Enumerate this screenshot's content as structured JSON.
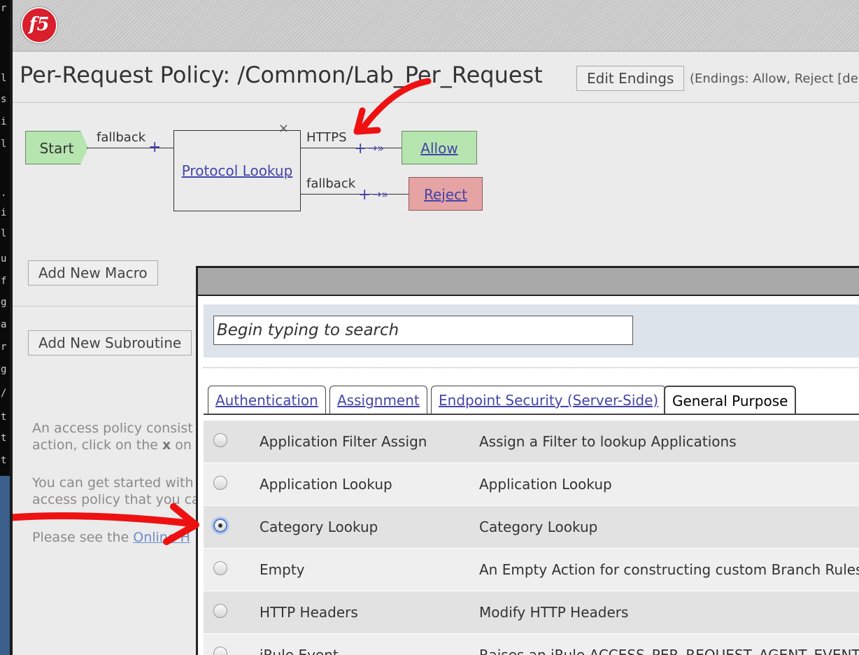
{
  "header": {
    "logo_text": "f5"
  },
  "policy": {
    "title": "Per-Request Policy: /Common/Lab_Per_Request",
    "edit_endings_label": "Edit Endings",
    "endings_note": "(Endings: Allow, Reject [de"
  },
  "flow": {
    "start": "Start",
    "start_branch": "fallback",
    "action_name": "Protocol Lookup",
    "close_glyph": "×",
    "branch_https": "HTTPS",
    "branch_fallback": "fallback",
    "plus": "+",
    "arrows": "→»",
    "ending_allow": "Allow",
    "ending_reject": "Reject"
  },
  "buttons": {
    "add_macro": "Add New Macro",
    "add_subroutine": "Add New Subroutine"
  },
  "help": {
    "line1": "An access policy consist",
    "line2a": "action, click on the ",
    "line2b": "x",
    "line2c": " on",
    "line3": "You can get started with",
    "line4": "access policy that you ca",
    "line5a": "Please see the ",
    "line5b": "Online H"
  },
  "dialog": {
    "search_placeholder": "Begin typing to search",
    "tabs": [
      "Authentication",
      "Assignment",
      "Endpoint Security (Server-Side)",
      "General Purpose"
    ],
    "items": [
      {
        "name": "Application Filter Assign",
        "description": "Assign a Filter to lookup Applications",
        "selected": false
      },
      {
        "name": "Application Lookup",
        "description": "Application Lookup",
        "selected": false
      },
      {
        "name": "Category Lookup",
        "description": "Category Lookup",
        "selected": true
      },
      {
        "name": "Empty",
        "description": "An Empty Action for constructing custom Branch Rules",
        "selected": false
      },
      {
        "name": "HTTP Headers",
        "description": "Modify HTTP Headers",
        "selected": false
      },
      {
        "name": "iRule Event",
        "description": "Raises an iRule ACCESS_PER_REQUEST_AGENT_EVENT",
        "selected": false
      }
    ]
  },
  "colors": {
    "annotation_arrow": "#ee1111",
    "allow_fill": "#b6e5b0",
    "reject_fill": "#e6a3a3",
    "link": "#4444aa"
  }
}
